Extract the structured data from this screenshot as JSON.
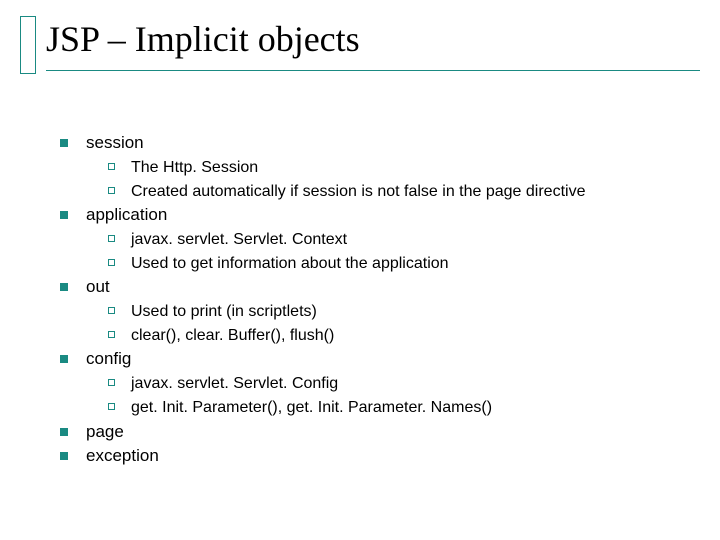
{
  "title": "JSP – Implicit objects",
  "items": [
    {
      "label": "session",
      "sub": [
        "The Http. Session",
        "Created automatically if session is not false in the page directive"
      ]
    },
    {
      "label": "application",
      "sub": [
        "javax. servlet. Servlet. Context",
        "Used to get information about the application"
      ]
    },
    {
      "label": "out",
      "sub": [
        "Used to print (in scriptlets)",
        "clear(), clear. Buffer(), flush()"
      ]
    },
    {
      "label": "config",
      "sub": [
        "javax. servlet. Servlet. Config",
        "get. Init. Parameter(), get. Init. Parameter. Names()"
      ]
    },
    {
      "label": "page",
      "sub": []
    },
    {
      "label": "exception",
      "sub": []
    }
  ]
}
